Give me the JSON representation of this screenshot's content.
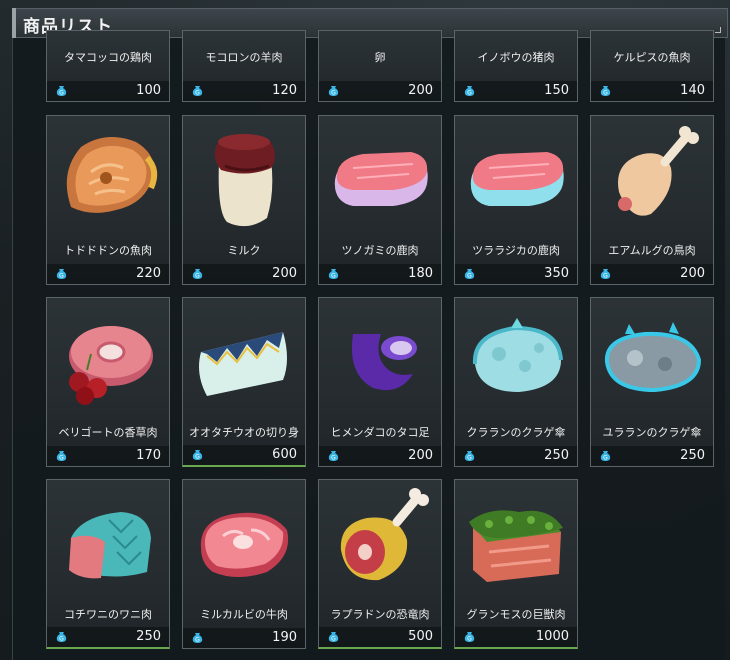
{
  "window": {
    "title": "商品リスト"
  },
  "items": [
    {
      "name": "タマコッコの鶏肉",
      "price": "100"
    },
    {
      "name": "モコロンの羊肉",
      "price": "120"
    },
    {
      "name": "卵",
      "price": "200"
    },
    {
      "name": "イノボウの猪肉",
      "price": "150"
    },
    {
      "name": "ケルピスの魚肉",
      "price": "140"
    },
    {
      "name": "トドドドンの魚肉",
      "price": "220"
    },
    {
      "name": "ミルク",
      "price": "200"
    },
    {
      "name": "ツノガミの鹿肉",
      "price": "180"
    },
    {
      "name": "ツララジカの鹿肉",
      "price": "350"
    },
    {
      "name": "エアムルグの鳥肉",
      "price": "200"
    },
    {
      "name": "ベリゴートの香草肉",
      "price": "170"
    },
    {
      "name": "オオタチウオの切り身",
      "price": "600"
    },
    {
      "name": "ヒメンダコのタコ足",
      "price": "200"
    },
    {
      "name": "クラランのクラゲ傘",
      "price": "250"
    },
    {
      "name": "ユラランのクラゲ傘",
      "price": "250"
    },
    {
      "name": "コチワニのワニ肉",
      "price": "250"
    },
    {
      "name": "ミルカルビの牛肉",
      "price": "190"
    },
    {
      "name": "ラプラドンの恐竜肉",
      "price": "500"
    },
    {
      "name": "グランモスの巨獣肉",
      "price": "1000"
    }
  ],
  "colors": {
    "currency": "#39b6e6",
    "highlight": "#6aa84f",
    "card_border": "#5b6469"
  }
}
